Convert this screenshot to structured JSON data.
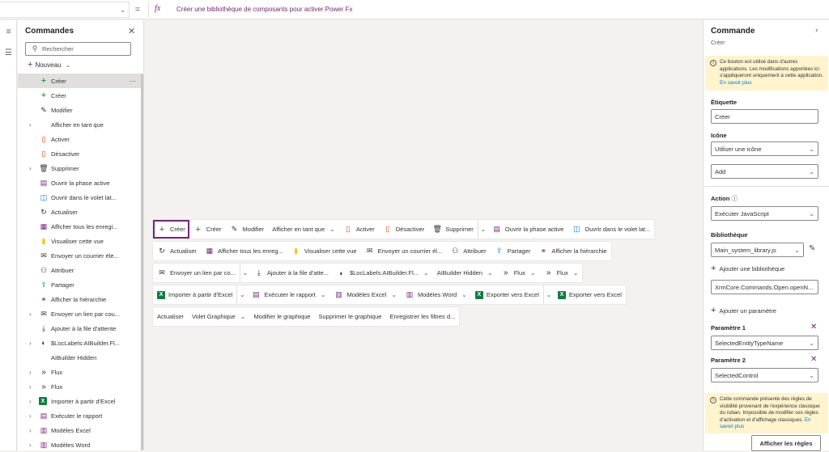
{
  "formula_bar": {
    "fx": "fx",
    "formula": "Créer une bibliothèque de composants pour activer Power Fx"
  },
  "left_panel": {
    "title": "Commandes",
    "search_placeholder": "Rechercher",
    "new_label": "Nouveau",
    "items": [
      {
        "label": "Créer",
        "icon": "plus-icon",
        "expand": false,
        "selected": true
      },
      {
        "label": "Créer",
        "icon": "plus-icon",
        "expand": false
      },
      {
        "label": "Modifier",
        "icon": "pencil-icon",
        "expand": false
      },
      {
        "label": "Afficher en tant que",
        "icon": "",
        "expand": true
      },
      {
        "label": "Activer",
        "icon": "document-icon",
        "expand": false
      },
      {
        "label": "Désactiver",
        "icon": "document-icon",
        "expand": false
      },
      {
        "label": "Supprimer",
        "icon": "trash-icon",
        "expand": true
      },
      {
        "label": "Ouvrir la phase active",
        "icon": "stage-icon",
        "expand": false
      },
      {
        "label": "Ouvrir dans le volet lat...",
        "icon": "panel-icon",
        "expand": false
      },
      {
        "label": "Actualiser",
        "icon": "refresh-icon",
        "expand": false
      },
      {
        "label": "Afficher tous les enregi...",
        "icon": "grid-icon",
        "expand": false
      },
      {
        "label": "Visualiser cette vue",
        "icon": "powerbi-icon",
        "expand": false
      },
      {
        "label": "Envoyer un courrier éle...",
        "icon": "mail-icon",
        "expand": false
      },
      {
        "label": "Attribuer",
        "icon": "person-icon",
        "expand": false
      },
      {
        "label": "Partager",
        "icon": "share-icon",
        "expand": false
      },
      {
        "label": "Afficher la hiérarchie",
        "icon": "hierarchy-icon",
        "expand": false
      },
      {
        "label": "Envoyer un lien par cou...",
        "icon": "mail-icon",
        "expand": true
      },
      {
        "label": "Ajouter à la file d'attente",
        "icon": "queue-icon",
        "expand": false
      },
      {
        "label": "$LocLabels:AIBuilder.Fl...",
        "icon": "aibuilder-icon",
        "expand": true
      },
      {
        "label": "AIBuilder Hidden",
        "icon": "",
        "expand": false
      },
      {
        "label": "Flux",
        "icon": "flow-icon",
        "expand": true
      },
      {
        "label": "Flux",
        "icon": "flow-icon",
        "expand": true
      },
      {
        "label": "Importer à partir d'Excel",
        "icon": "excel-icon",
        "expand": true
      },
      {
        "label": "Exécuter le rapport",
        "icon": "report-icon",
        "expand": true
      },
      {
        "label": "Modèles Excel",
        "icon": "template-icon",
        "expand": true
      },
      {
        "label": "Modèles Word",
        "icon": "template-icon",
        "expand": true
      }
    ]
  },
  "command_rows": [
    [
      {
        "label": "Créer",
        "icon": "plus-icon",
        "highlight": true
      },
      {
        "label": "Créer",
        "icon": "plus-icon"
      },
      {
        "label": "Modifier",
        "icon": "pencil-icon"
      },
      {
        "label": "Afficher en tant que",
        "icon": "",
        "dropdown": true
      },
      {
        "label": "Activer",
        "icon": "document-icon"
      },
      {
        "label": "Désactiver",
        "icon": "document-icon"
      },
      {
        "label": "Supprimer",
        "icon": "trash-icon",
        "split": true
      },
      {
        "label": "Ouvrir la phase active",
        "icon": "stage-icon"
      },
      {
        "label": "Ouvrir dans le volet lat...",
        "icon": "panel-icon"
      }
    ],
    [
      {
        "label": "Actualiser",
        "icon": "refresh-icon"
      },
      {
        "label": "Afficher tous les enreg...",
        "icon": "grid-icon"
      },
      {
        "label": "Visualiser cette vue",
        "icon": "powerbi-icon"
      },
      {
        "label": "Envoyer un courrier él...",
        "icon": "mail-icon"
      },
      {
        "label": "Attribuer",
        "icon": "person-icon"
      },
      {
        "label": "Partager",
        "icon": "share-icon"
      },
      {
        "label": "Afficher la hiérarchie",
        "icon": "hierarchy-icon"
      }
    ],
    [
      {
        "label": "Envoyer un lien par co...",
        "icon": "mail-icon",
        "split": true
      },
      {
        "label": "Ajouter à la file d'atte...",
        "icon": "queue-icon"
      },
      {
        "label": "$LocLabels:AIBuilder.Fl...",
        "icon": "aibuilder-icon",
        "dropdown": true
      },
      {
        "label": "AIBuilder Hidden",
        "icon": "",
        "dropdown": true
      },
      {
        "label": "Flux",
        "icon": "flow-icon",
        "dropdown": true
      },
      {
        "label": "Flux",
        "icon": "flow-icon",
        "dropdown": true
      }
    ],
    [
      {
        "label": "Importer à partir d'Excel",
        "icon": "excel-icon",
        "split": true
      },
      {
        "label": "Exécuter le rapport",
        "icon": "report-icon",
        "dropdown": true
      },
      {
        "label": "Modèles Excel",
        "icon": "template-icon",
        "dropdown": true
      },
      {
        "label": "Modèles Word",
        "icon": "template-icon",
        "dropdown": true
      },
      {
        "label": "Exporter vers Excel",
        "icon": "excel-icon",
        "split": true
      },
      {
        "label": "Exporter vers Excel",
        "icon": "excel-icon"
      }
    ],
    [
      {
        "label": "Actualiser",
        "icon": ""
      },
      {
        "label": "Volet Graphique",
        "icon": "",
        "dropdown": true
      },
      {
        "label": "Modifier le graphique",
        "icon": ""
      },
      {
        "label": "Supprimer le graphique",
        "icon": ""
      },
      {
        "label": "Enregistrer les filtres d...",
        "icon": ""
      }
    ]
  ],
  "right_panel": {
    "title": "Commande",
    "subtitle": "Créer",
    "warning_top": "Ce bouton est utilisé dans d'autres applications. Les modifications apportées ici s'appliqueront uniquement à cette application.",
    "warning_top_link": "En savoir plus",
    "label_heading": "Étiquette",
    "label_value": "Créer",
    "icon_heading": "Icône",
    "icon_value": "Utiliser une icône",
    "icon_add_value": "Add",
    "action_heading": "Action",
    "action_value": "Exécuter JavaScript",
    "library_heading": "Bibliothèque",
    "library_value": "Main_system_library.js",
    "add_library": "Ajouter une bibliothèque",
    "function_value": "XrmCore.Commands.Open.openN...",
    "add_param": "Ajouter un paramètre",
    "param1_heading": "Paramètre 1",
    "param1_value": "SelectedEntityTypeName",
    "param2_heading": "Paramètre 2",
    "param2_value": "SelectedControl",
    "warning_bottom": "Cette commande présente des règles de visibilité provenant de l'expérience classique du ruban. Impossible de modifier ces règles d'activation et d'affichage classiques.",
    "warning_bottom_link": "En savoir plus",
    "show_rules": "Afficher les règles"
  },
  "colors": {
    "accent": "#742774",
    "link": "#0078d4",
    "warning_bg": "#fff4ce"
  }
}
